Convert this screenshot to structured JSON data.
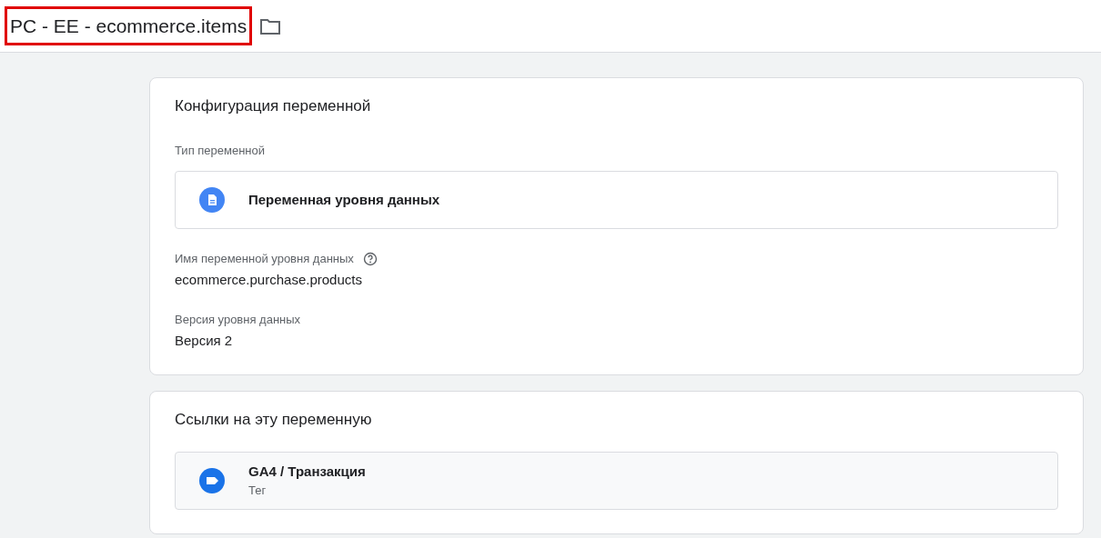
{
  "header": {
    "title": "PC - EE - ecommerce.items",
    "highlighted": true
  },
  "config_card": {
    "title": "Конфигурация переменной",
    "type_label": "Тип переменной",
    "type_value": "Переменная уровня данных",
    "fields": [
      {
        "label": "Имя переменной уровня данных",
        "value": "ecommerce.purchase.products",
        "help": true
      },
      {
        "label": "Версия уровня данных",
        "value": "Версия 2",
        "help": false
      }
    ]
  },
  "references_card": {
    "title": "Ссылки на эту переменную",
    "items": [
      {
        "name": "GA4 / Транзакция",
        "kind": "tag",
        "type": "Тег"
      }
    ]
  }
}
